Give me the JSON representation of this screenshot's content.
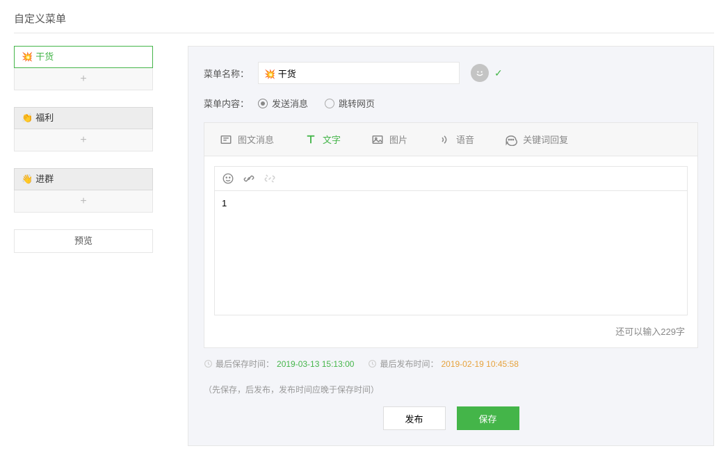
{
  "pageTitle": "自定义菜单",
  "sidebar": {
    "groups": [
      {
        "emoji": "💥",
        "label": "干货",
        "active": true
      },
      {
        "emoji": "👏",
        "label": "福利",
        "active": false
      },
      {
        "emoji": "👋",
        "label": "进群",
        "active": false
      }
    ],
    "previewLabel": "预览"
  },
  "form": {
    "nameLabel": "菜单名称：",
    "nameValue": "💥 干货",
    "contentLabel": "菜单内容：",
    "radios": {
      "send": "发送消息",
      "jump": "跳转网页"
    }
  },
  "tabs": {
    "news": "图文消息",
    "text": "文字",
    "image": "图片",
    "voice": "语音",
    "keyword": "关键词回复"
  },
  "editor": {
    "content": "1",
    "charCountPrefix": "还可以输入",
    "charCountNum": "229",
    "charCountSuffix": "字"
  },
  "footer": {
    "saveTimeLabel": "最后保存时间：",
    "saveTimeValue": "2019-03-13 15:13:00",
    "publishTimeLabel": "最后发布时间：",
    "publishTimeValue": "2019-02-19 10:45:58",
    "hint": "（先保存，后发布，发布时间应晚于保存时间）",
    "publishBtn": "发布",
    "saveBtn": "保存"
  }
}
